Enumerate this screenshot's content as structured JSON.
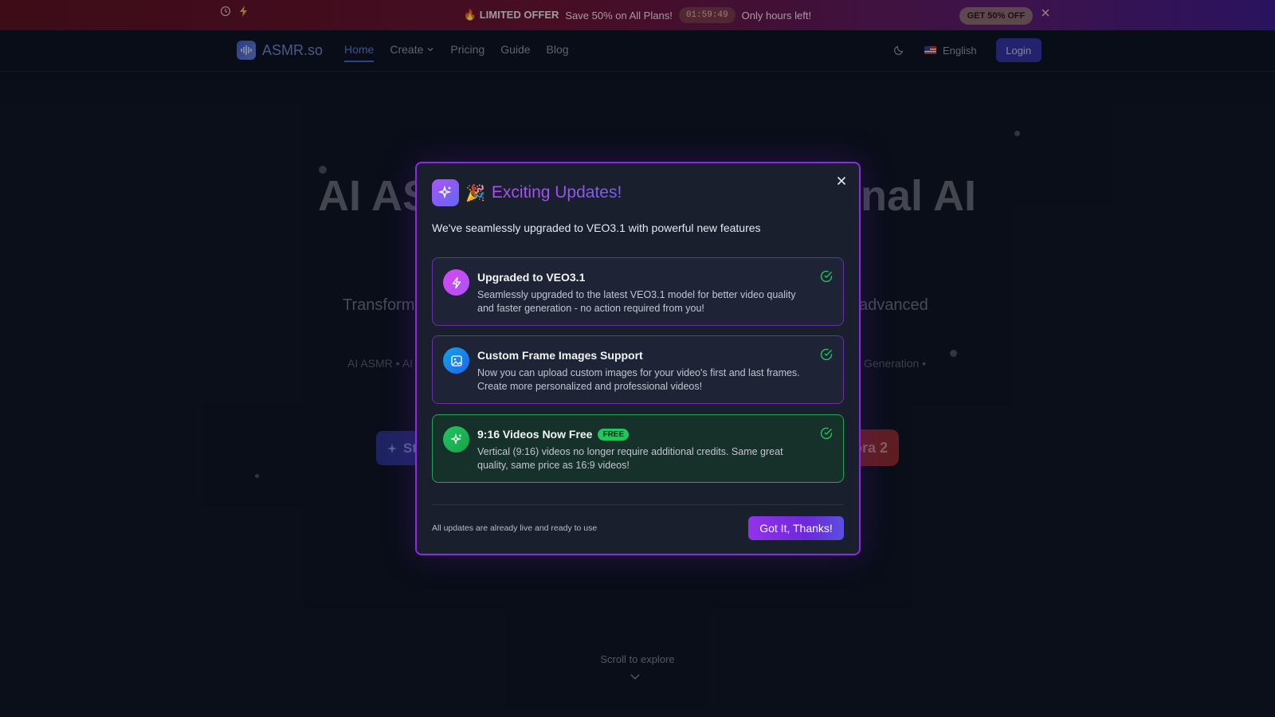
{
  "promo": {
    "fire_icon": "fire-icon",
    "offer_label": "🔥 LIMITED OFFER",
    "offer_text": "Save 50% on All Plans!",
    "timer": "01:59:49",
    "urgency": "Only hours left!",
    "cta": "GET 50% OFF"
  },
  "nav": {
    "brand": "ASMR.so",
    "links": {
      "home": "Home",
      "create": "Create",
      "pricing": "Pricing",
      "guide": "Guide",
      "blog": "Blog"
    },
    "language": "English",
    "login": "Login"
  },
  "hero": {
    "title_left": "AI AS",
    "title_right": "nal AI",
    "sub_left": "Transform",
    "sub_right": "advanced",
    "tags_left": "AI ASMR • AI",
    "tags_right": "Generation •",
    "start_btn": "St",
    "sora_btn": "ora 2",
    "scroll": "Scroll to explore"
  },
  "modal": {
    "party": "🎉",
    "title": "Exciting Updates!",
    "description": "We've seamlessly upgraded to VEO3.1 with powerful new features",
    "cards": [
      {
        "title": "Upgraded to VEO3.1",
        "text": "Seamlessly upgraded to the latest VEO3.1 model for better video quality and faster generation - no action required from you!"
      },
      {
        "title": "Custom Frame Images Support",
        "text": "Now you can upload custom images for your video's first and last frames. Create more personalized and professional videos!"
      },
      {
        "title": "9:16 Videos Now Free",
        "badge": "FREE",
        "text": "Vertical (9:16) videos no longer require additional credits. Same great quality, same price as 16:9 videos!"
      }
    ],
    "footer_note": "All updates are already live and ready to use",
    "confirm": "Got It, Thanks!"
  },
  "colors": {
    "accent_purple": "#a855f7",
    "modal_border": "#8a2be2",
    "success_green": "#22c55e",
    "bolt_pink": "#c43dd8",
    "image_blue": "#1d9bd8"
  }
}
